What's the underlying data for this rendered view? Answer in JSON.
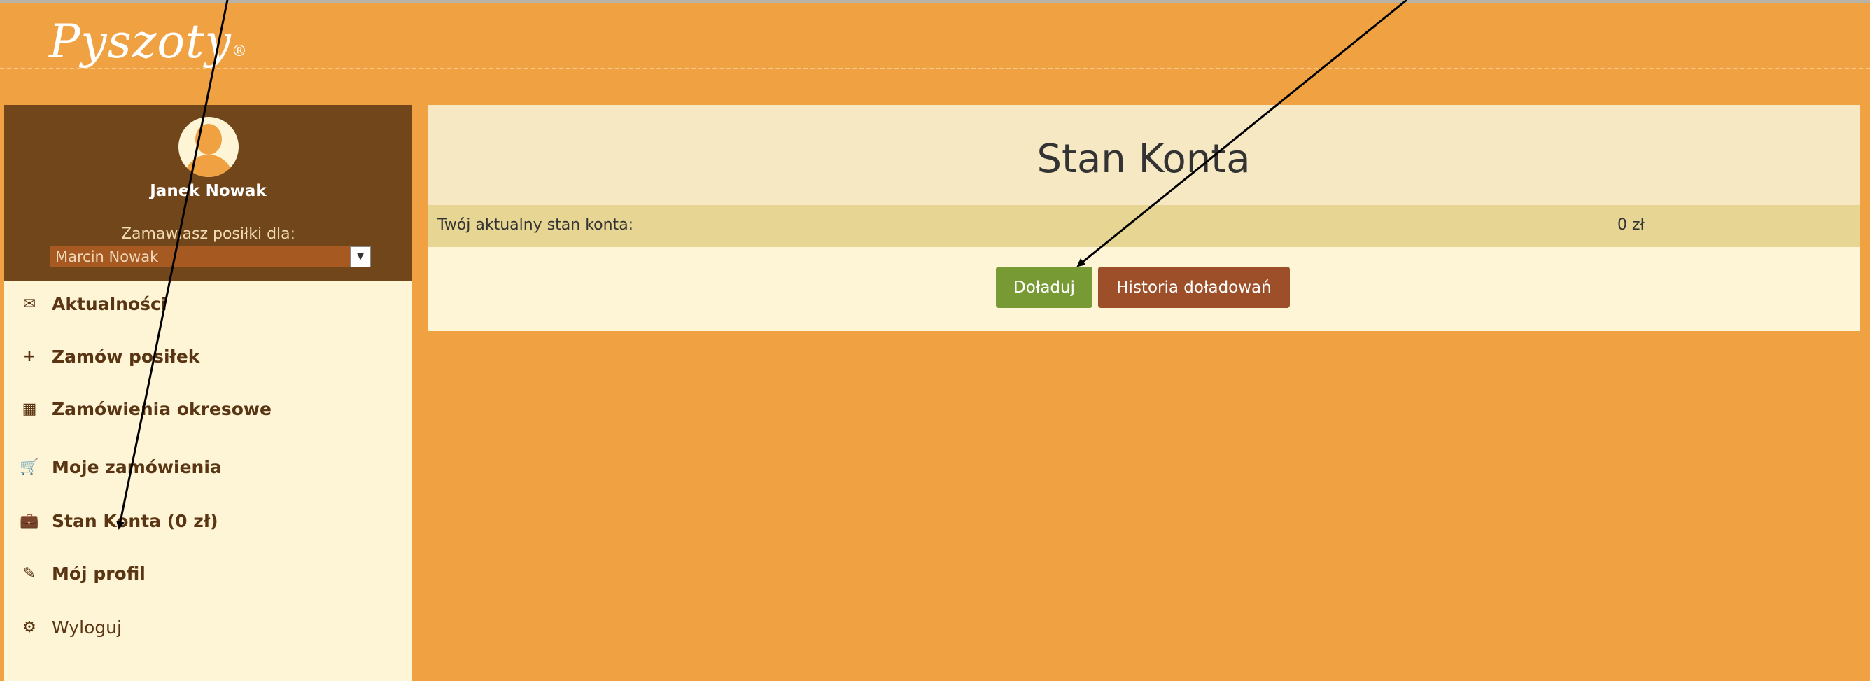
{
  "brand": {
    "logo": "Pyszoty",
    "mark": "®"
  },
  "user": {
    "name": "Janek Nowak",
    "order_for_label": "Zamawiasz posiłki dla:",
    "order_for_selected": "Marcin Nowak"
  },
  "menu": [
    {
      "icon": "envelope-icon",
      "glyph": "✉",
      "label": "Aktualności"
    },
    {
      "icon": "plus-icon",
      "glyph": "+",
      "label": "Zamów posiłek"
    },
    {
      "icon": "calendar-icon",
      "glyph": "▦",
      "label": "Zamówienia okresowe"
    },
    {
      "icon": "cart-icon",
      "glyph": "🛒",
      "label": "Moje zamówienia"
    },
    {
      "icon": "briefcase-icon",
      "glyph": "💼",
      "label": "Stan Konta (0 zł)"
    },
    {
      "icon": "pencil-icon",
      "glyph": "✎",
      "label": "Mój profil"
    },
    {
      "icon": "gear-icon",
      "glyph": "⚙",
      "label": "Wyloguj"
    }
  ],
  "main": {
    "title": "Stan Konta",
    "balance_label": "Twój aktualny stan konta:",
    "balance_value": "0 zł",
    "topup_label": "Doładuj",
    "history_label": "Historia doładowań"
  },
  "colors": {
    "background": "#f0a243",
    "sidebar_header": "#71461a",
    "sidebar_bg": "#fdf5d5",
    "panel_header": "#f5e8c2",
    "balance_row": "#e7d594",
    "topup_button": "#789a34",
    "history_button": "#9c4f29"
  }
}
